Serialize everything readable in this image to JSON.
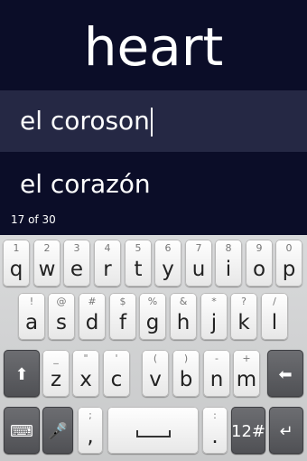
{
  "app": {
    "prompt_word": "heart",
    "answer_input": "el coroson",
    "correct_answer": "el corazón",
    "progress": "17 of 30"
  },
  "keyboard": {
    "row1": [
      {
        "hint": "1",
        "key": "q"
      },
      {
        "hint": "2",
        "key": "w"
      },
      {
        "hint": "3",
        "key": "e"
      },
      {
        "hint": "4",
        "key": "r"
      },
      {
        "hint": "5",
        "key": "t"
      },
      {
        "hint": "6",
        "key": "y"
      },
      {
        "hint": "7",
        "key": "u"
      },
      {
        "hint": "8",
        "key": "i"
      },
      {
        "hint": "9",
        "key": "o"
      },
      {
        "hint": "0",
        "key": "p"
      }
    ],
    "row2": [
      {
        "hint": "!",
        "key": "a"
      },
      {
        "hint": "@",
        "key": "s"
      },
      {
        "hint": "#",
        "key": "d"
      },
      {
        "hint": "$",
        "key": "f"
      },
      {
        "hint": "%",
        "key": "g"
      },
      {
        "hint": "&",
        "key": "h"
      },
      {
        "hint": "*",
        "key": "j"
      },
      {
        "hint": "?",
        "key": "k"
      },
      {
        "hint": "/",
        "key": "l"
      }
    ],
    "row3": [
      {
        "hint": "_",
        "key": "z"
      },
      {
        "hint": "\"",
        "key": "x"
      },
      {
        "hint": "'",
        "key": "c"
      },
      {
        "hint": "(",
        "key": "v"
      },
      {
        "hint": ")",
        "key": "b"
      },
      {
        "hint": "-",
        "key": "n"
      },
      {
        "hint": "+",
        "key": "m"
      }
    ],
    "bottom": {
      "comma_hint": ";",
      "comma": ",",
      "period_hint": ":",
      "period": ".",
      "symbols": "12#",
      "shift_icon": "⬆",
      "backspace_icon": "⬅",
      "mic_icon": "🎤",
      "keyboard_icon": "⌨",
      "enter_icon": "↵"
    }
  }
}
